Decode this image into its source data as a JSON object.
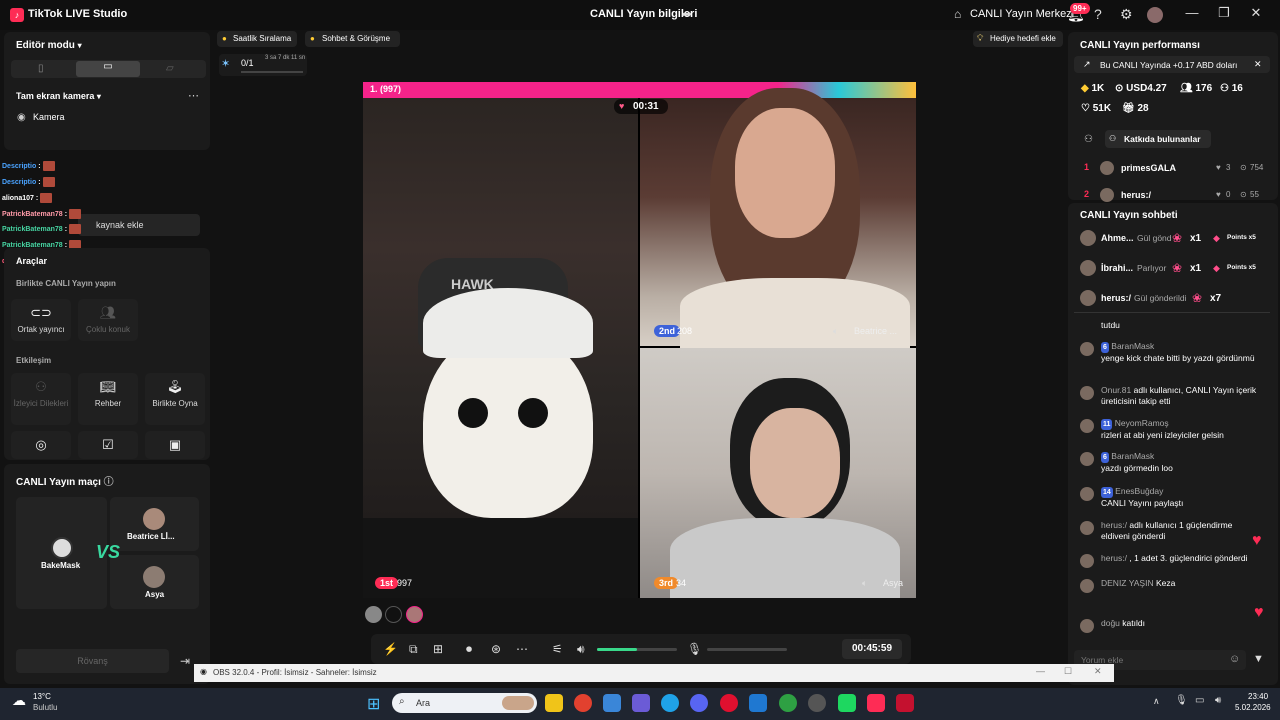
{
  "titlebar": {
    "app_name": "TikTok LIVE Studio",
    "center_title": "CANLI Yayın bilgileri",
    "live_center": "CANLI Yayın Merkezi",
    "notif_count": "99+"
  },
  "left": {
    "editor_mode": "Editör modu",
    "fullscreen_camera": "Tam ekran kamera",
    "camera": "Kamera",
    "add_source": "kaynak ekle",
    "tools": "Araçlar",
    "co_live": "Birlikte CANLI Yayın yapın",
    "co_host": "Ortak yayıncı",
    "multi_guest": "Çoklu konuk",
    "interaction": "Etkileşim",
    "viewer_wishes": "İzleyici Dilekleri",
    "guide": "Rehber",
    "play_together": "Birlikte Oyna",
    "match_title": "CANLI Yayın maçı",
    "players": [
      {
        "name": "BakeMask"
      },
      {
        "name": "Beatrice Lİ..."
      },
      {
        "name": "Asya"
      }
    ],
    "rematch": "Rövanş",
    "chat_overlay": [
      {
        "name": "Descriptio",
        "color": "#4aa3ff"
      },
      {
        "name": "Descriptio",
        "color": "#4aa3ff"
      },
      {
        "name": "aliona107",
        "color": "#ffffff"
      },
      {
        "name": "PatrickBateman78",
        "color": "#ff9aa8"
      },
      {
        "name": "PatrickBateman78",
        "color": "#46d3a1"
      },
      {
        "name": "PatrickBateman78",
        "color": "#46d3a1"
      },
      {
        "name": "dumbroggie00",
        "color": "#ff5a7a"
      }
    ]
  },
  "center": {
    "hourly_rank": "Saatlik Sıralama",
    "chat_meet": "Sohbet & Görüşme",
    "gift_goal": "Hediye hedefi ekle",
    "progress": "0/1",
    "progress_time": "3 sa 7 dk 11 sn",
    "rank_label": "1.",
    "rank_score": "(997)",
    "timer": "00:31",
    "p2_place": "2nd",
    "p2_score": "208",
    "p2_name": "Beatrice ...",
    "p1_place": "1st",
    "p1_score": "997",
    "p3_place": "3rd",
    "p3_score": "34",
    "p3_name": "Asya",
    "elapsed": "00:45:59",
    "volume_level": 0.5
  },
  "right": {
    "perf_title": "CANLI Yayın performansı",
    "notice": "Bu CANLI Yayında +0.17 ABD doları",
    "stats": {
      "diamonds": "1K",
      "usd": "USD4.27",
      "viewers": "176",
      "followers": "16",
      "likes": "51K",
      "gifters": "28"
    },
    "contributors_btn": "Katkıda bulunanlar",
    "contributors": [
      {
        "rank": "1",
        "name": "primesGALA",
        "a": "3",
        "b": "754"
      },
      {
        "rank": "2",
        "name": "herus:/",
        "a": "0",
        "b": "55"
      }
    ],
    "chat_title": "CANLI Yayın sohbeti",
    "gift_rows": [
      {
        "name": "Ahme...",
        "action": "Gül gönd",
        "count": "x1",
        "points": "Points x5"
      },
      {
        "name": "İbrahi...",
        "action": "Parlıyor",
        "count": "x1",
        "points": "Points x5"
      },
      {
        "name": "herus:/",
        "action": "Gül gönderildi",
        "count": "x7",
        "points": ""
      }
    ],
    "messages": [
      {
        "user": "",
        "badge": "",
        "text": "tutdu"
      },
      {
        "user": "BaranMask",
        "badge": "6",
        "text": "yenge kick chate bitti by yazdı gördünmü"
      },
      {
        "user": "Onur.81",
        "badge": "",
        "text": "adlı kullanıcı, CANLI Yayın içerik üreticisini takip etti"
      },
      {
        "user": "NeyomRamoş",
        "badge": "11",
        "text": "rizleri at abi yeni izleyiciler gelsin"
      },
      {
        "user": "BaranMask",
        "badge": "6",
        "text": "yazdı görmedin loo"
      },
      {
        "user": "EnesBuğday",
        "badge": "14",
        "text": "CANLI Yayını paylaştı"
      },
      {
        "user": "herus:/",
        "badge": "",
        "text": "adlı kullanıcı 1 güçlendirme eldiveni gönderdi"
      },
      {
        "user": "herus:/",
        "badge": "",
        "text": ", 1 adet 3. güçlendirici gönderdi"
      },
      {
        "user": "DENIZ YAŞIN",
        "badge": "",
        "text": "Keza"
      },
      {
        "user": "doğu",
        "badge": "",
        "text": "katıldı"
      }
    ],
    "comment_placeholder": "Yorum ekle"
  },
  "obs": {
    "title": "OBS 32.0.4 - Profil: İsimsiz - Sahneler: İsimsiz"
  },
  "taskbar": {
    "temp": "13°C",
    "weather": "Bulutlu",
    "search": "Ara",
    "time": "23:40",
    "date": "5.02.2026"
  }
}
